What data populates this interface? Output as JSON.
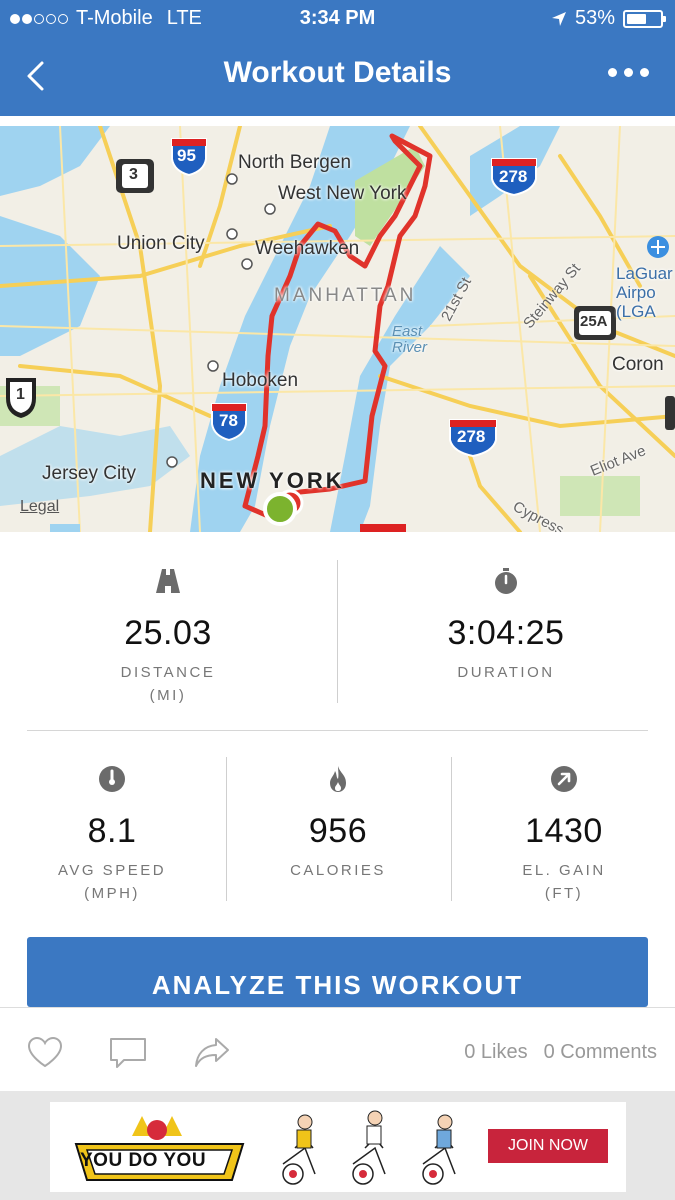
{
  "status_bar": {
    "carrier": "T-Mobile",
    "network": "LTE",
    "time": "3:34 PM",
    "battery": "53%",
    "battery_level": 0.53,
    "signal_bars": 2
  },
  "header": {
    "title": "Workout Details",
    "back_icon": "chevron-left-icon",
    "more_icon": "more-dots-icon"
  },
  "map": {
    "labels": {
      "north_bergen": "North Bergen",
      "west_new_york": "West New York",
      "union_city": "Union City",
      "weehawken": "Weehawken",
      "manhattan": "MANHATTAN",
      "hoboken": "Hoboken",
      "jersey_city": "Jersey City",
      "new_york": "NEW YORK",
      "east_river": "East\nRiver",
      "street_21": "21st St",
      "steinway": "Steinway St",
      "laguardia": "LaGuar\nAirpo\n(LGA",
      "corona": "Coron",
      "eliot": "Eliot Ave",
      "cypress": "Cypress"
    },
    "shields": {
      "i95": "95",
      "i278a": "278",
      "i278b": "278",
      "i78": "78",
      "r3": "3",
      "r1": "1",
      "r25a": "25A"
    },
    "legal": "Legal",
    "route_color": "#e0332b",
    "start_color": "#7cb32e"
  },
  "stats": {
    "distance": {
      "value": "25.03",
      "label": "DISTANCE",
      "unit": "(MI)",
      "icon": "road-icon"
    },
    "duration": {
      "value": "3:04:25",
      "label": "DURATION",
      "icon": "stopwatch-icon"
    },
    "avg_speed": {
      "value": "8.1",
      "label": "AVG SPEED",
      "unit": "(MPH)",
      "icon": "speedometer-icon"
    },
    "calories": {
      "value": "956",
      "label": "CALORIES",
      "icon": "flame-icon"
    },
    "elevation": {
      "value": "1430",
      "label": "EL. GAIN",
      "unit": "(FT)",
      "icon": "arrow-up-right-icon"
    }
  },
  "actions": {
    "analyze": "ANALYZE THIS WORKOUT"
  },
  "social": {
    "likes": "0 Likes",
    "comments": "0 Comments"
  },
  "ad": {
    "logo_text": "YOU DO YOU",
    "cta": "JOIN NOW"
  },
  "colors": {
    "primary": "#3b78c2",
    "ad_cta": "#c8243c"
  }
}
